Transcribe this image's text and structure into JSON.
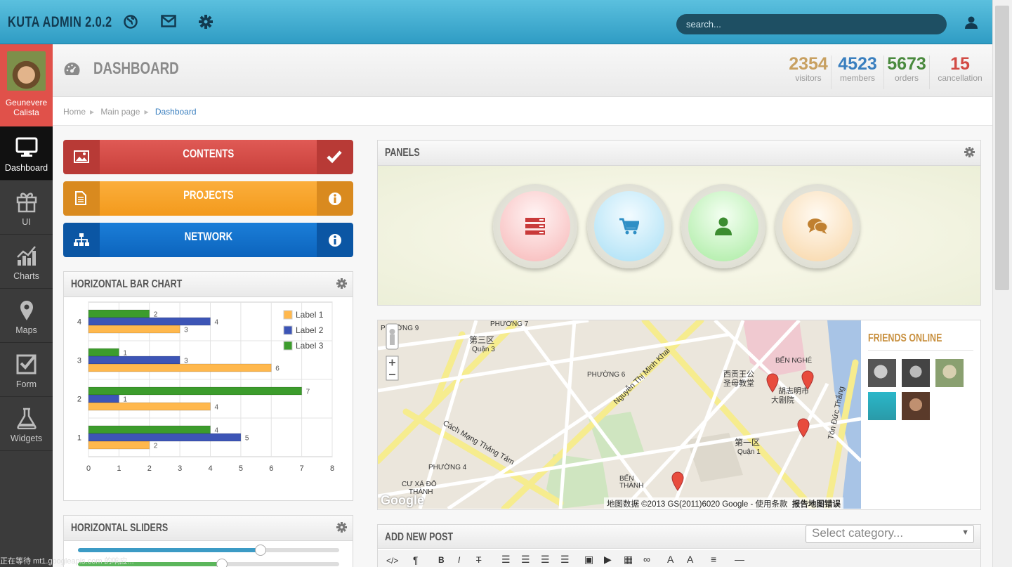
{
  "app": {
    "title": "KUTA ADMIN 2.0.2"
  },
  "search": {
    "placeholder": "search..."
  },
  "profile": {
    "name_line1": "Geunevere",
    "name_line2": "Calista"
  },
  "nav": [
    {
      "label": "Dashboard",
      "icon": "monitor-icon",
      "active": true
    },
    {
      "label": "UI",
      "icon": "gift-icon"
    },
    {
      "label": "Charts",
      "icon": "bar-chart-icon"
    },
    {
      "label": "Maps",
      "icon": "map-marker-icon"
    },
    {
      "label": "Form",
      "icon": "checkbox-icon"
    },
    {
      "label": "Widgets",
      "icon": "flask-icon"
    }
  ],
  "header": {
    "title": "DASHBOARD"
  },
  "stats": [
    {
      "value": "2354",
      "label": "visitors",
      "color": "#c8a060"
    },
    {
      "value": "4523",
      "label": "members",
      "color": "#3a7fbf"
    },
    {
      "value": "5673",
      "label": "orders",
      "color": "#4a8a3e"
    },
    {
      "value": "15",
      "label": "cancellation",
      "color": "#d24b45"
    }
  ],
  "breadcrumb": [
    "Home",
    "Main page",
    "Dashboard"
  ],
  "buttons": [
    {
      "label": "CONTENTS",
      "icon": "image-icon",
      "right_icon": "check-icon",
      "color": "#d9534f"
    },
    {
      "label": "PROJECTS",
      "icon": "document-icon",
      "right_icon": "info-icon",
      "color": "#f9a22c"
    },
    {
      "label": "NETWORK",
      "icon": "sitemap-icon",
      "right_icon": "info-icon",
      "color": "#0e6fcb"
    }
  ],
  "bar_chart_panel": {
    "title": "HORIZONTAL BAR CHART"
  },
  "chart_data": {
    "type": "bar",
    "orientation": "horizontal",
    "categories": [
      "1",
      "2",
      "3",
      "4"
    ],
    "series": [
      {
        "name": "Label 1",
        "values": [
          2,
          4,
          6,
          3
        ],
        "color": "#ffb84d"
      },
      {
        "name": "Label 2",
        "values": [
          5,
          1,
          3,
          4
        ],
        "color": "#3d55b6"
      },
      {
        "name": "Label 3",
        "values": [
          4,
          7,
          1,
          2
        ],
        "color": "#3c9c2c"
      }
    ],
    "xlim": [
      0,
      8
    ],
    "xticks": [
      "0",
      "1",
      "2",
      "3",
      "4",
      "5",
      "6",
      "7",
      "8"
    ],
    "grid": true,
    "legend": "top-right"
  },
  "sliders_panel": {
    "title": "HORIZONTAL SLIDERS",
    "values": [
      0.7,
      0.55
    ]
  },
  "panels_panel": {
    "title": "PANELS"
  },
  "circles": [
    {
      "icon": "list-icon",
      "color": "#c93a3a"
    },
    {
      "icon": "cart-icon",
      "color": "#2f8fc5"
    },
    {
      "icon": "user-icon",
      "color": "#3c8c30"
    },
    {
      "icon": "comments-icon",
      "color": "#c08030"
    }
  ],
  "map": {
    "labels": [
      "PHƯỜNG 9",
      "第三区",
      "Quận 3",
      "PHƯỜNG 7",
      "PHƯỜNG 6",
      "BẾN NGHÉ",
      "西贡王公",
      "圣母教堂",
      "胡志明市",
      "大剧院",
      "第一区",
      "Quận 1",
      "PHƯỜNG 4",
      "CƯ XÁ ĐÔ",
      "THÀNH",
      "BẾN",
      "THÀNH",
      "Nguyễn Thị Minh Khai",
      "Cách Mạng Tháng Tám",
      "Tôn Đức Thắng"
    ],
    "footer": "地图数据 ©2013 GS(2011)6020 Google - 使用条款",
    "report": "报告地图错误",
    "google": "Google"
  },
  "friends": {
    "title": "FRIENDS ONLINE",
    "count": 5
  },
  "post_panel": {
    "title": "ADD NEW POST",
    "select_placeholder": "Select category..."
  },
  "status": {
    "text": "正在等待 mt1.googleapis.com 的响应..."
  }
}
